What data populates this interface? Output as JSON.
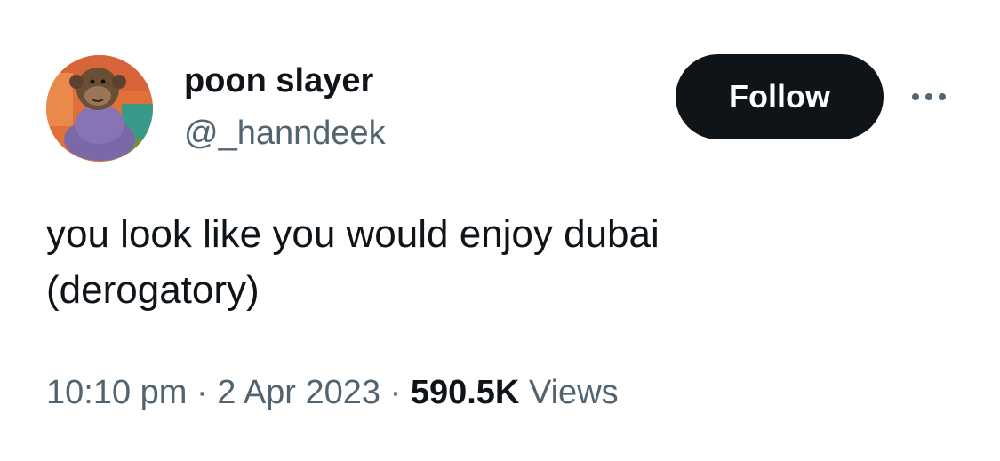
{
  "author": {
    "display_name": "poon slayer",
    "handle": "@_hanndeek"
  },
  "actions": {
    "follow_label": "Follow",
    "more_icon": "more-horizontal-icon"
  },
  "tweet": {
    "text_line_1": "you look like you would enjoy dubai",
    "text_line_2": "(derogatory)"
  },
  "meta": {
    "time": "10:10 pm",
    "date": "2 Apr 2023",
    "separator": "·",
    "views_count": "590.5K",
    "views_label": "Views"
  },
  "colors": {
    "text_primary": "#0f1419",
    "text_secondary": "#536471",
    "button_bg": "#0f1419",
    "button_text": "#ffffff"
  }
}
